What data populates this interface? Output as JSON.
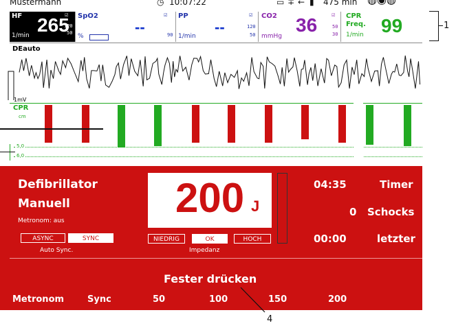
{
  "topbar": {
    "patient": "Mustermann",
    "clock": "10:07:22",
    "battery": "475 min"
  },
  "tiles": {
    "hf": {
      "label": "HF",
      "value": "265",
      "unit": "1/min",
      "limit_hi": "120",
      "limit_lo": "50"
    },
    "spo2": {
      "label": "SpO2",
      "value": "--",
      "unit": "%",
      "limit_hi": "",
      "limit_lo": "90"
    },
    "pp": {
      "label": "PP",
      "value": "--",
      "unit": "1/min",
      "limit_hi": "120",
      "limit_lo": "50"
    },
    "co2": {
      "label": "CO2",
      "value": "36",
      "unit": "mmHg",
      "limit_hi": "50",
      "limit_lo": "30"
    },
    "cpr": {
      "label": "CPR",
      "label2": "Freq.",
      "value": "99",
      "unit": "1/min"
    }
  },
  "ecg": {
    "lead": "DEauto",
    "scale": "1mV"
  },
  "cpr_trace": {
    "label": "CPR",
    "unit": "cm",
    "line_hi": "5,0",
    "line_lo": "6,0",
    "compressions": [
      {
        "depth": 0.55,
        "ok": false
      },
      {
        "depth": 0.55,
        "ok": false
      },
      {
        "depth": 0.62,
        "ok": true
      },
      {
        "depth": 0.6,
        "ok": true
      },
      {
        "depth": 0.55,
        "ok": false
      },
      {
        "depth": 0.55,
        "ok": false
      },
      {
        "depth": 0.55,
        "ok": false
      },
      {
        "depth": 0.5,
        "ok": false
      },
      {
        "depth": 0.55,
        "ok": false
      },
      {
        "depth": 0.58,
        "ok": true
      },
      {
        "depth": 0.6,
        "ok": true
      }
    ],
    "colors": {
      "ok": "#22aa22",
      "bad": "#cc1111"
    }
  },
  "defib": {
    "title1": "Defibrillator",
    "title2": "Manuell",
    "metronome": "Metronom: aus",
    "sync_buttons": [
      "ASYNC",
      "SYNC"
    ],
    "sync_caption": "Auto Sync.",
    "energy": "200",
    "energy_unit": "J",
    "impedance_buttons": [
      "NIEDRIG",
      "OK",
      "HOCH"
    ],
    "impedance_caption": "Impedanz",
    "timer_value": "04:35",
    "timer_label": "Timer",
    "shocks_value": "0",
    "shocks_label": "Schocks",
    "last_value": "00:00",
    "last_label": "letzter",
    "prompt": "Fester drücken"
  },
  "softkeys": [
    "Metronom",
    "Sync",
    "50",
    "100",
    "150",
    "200"
  ],
  "callouts": {
    "one": "1",
    "four": "4"
  }
}
